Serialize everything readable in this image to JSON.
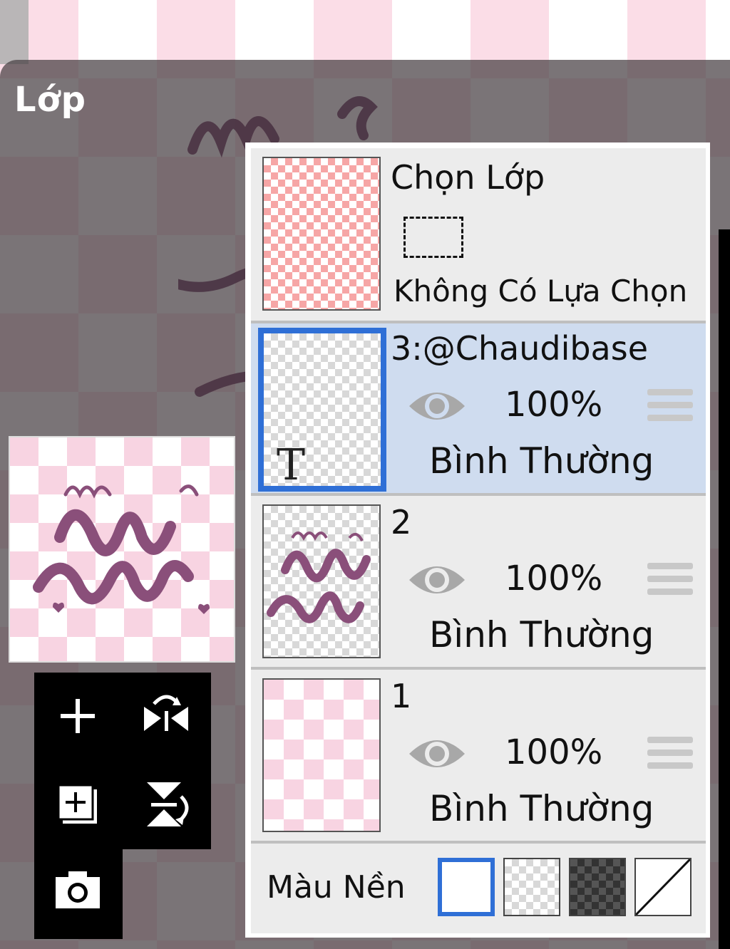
{
  "panel": {
    "title": "Lớp"
  },
  "selection_row": {
    "title": "Chọn Lớp",
    "status": "Không Có Lựa Chọn"
  },
  "layers": [
    {
      "name": "3:@Chaudibase",
      "opacity": "100%",
      "blend": "Bình Thường",
      "selected": true,
      "type_badge": "T"
    },
    {
      "name": "2",
      "opacity": "100%",
      "blend": "Bình Thường",
      "selected": false
    },
    {
      "name": "1",
      "opacity": "100%",
      "blend": "Bình Thường",
      "selected": false
    }
  ],
  "background": {
    "label": "Màu Nền",
    "swatches": [
      "white",
      "transparent-light",
      "transparent-dark",
      "none"
    ],
    "selected": "white"
  },
  "tools": [
    "add-layer",
    "flip-horizontal",
    "duplicate-layer",
    "flip-vertical",
    "camera"
  ],
  "colors": {
    "selected_border": "#2f6fd6",
    "selected_row": "#cfdcef",
    "artwork": "#8a4f7a"
  }
}
